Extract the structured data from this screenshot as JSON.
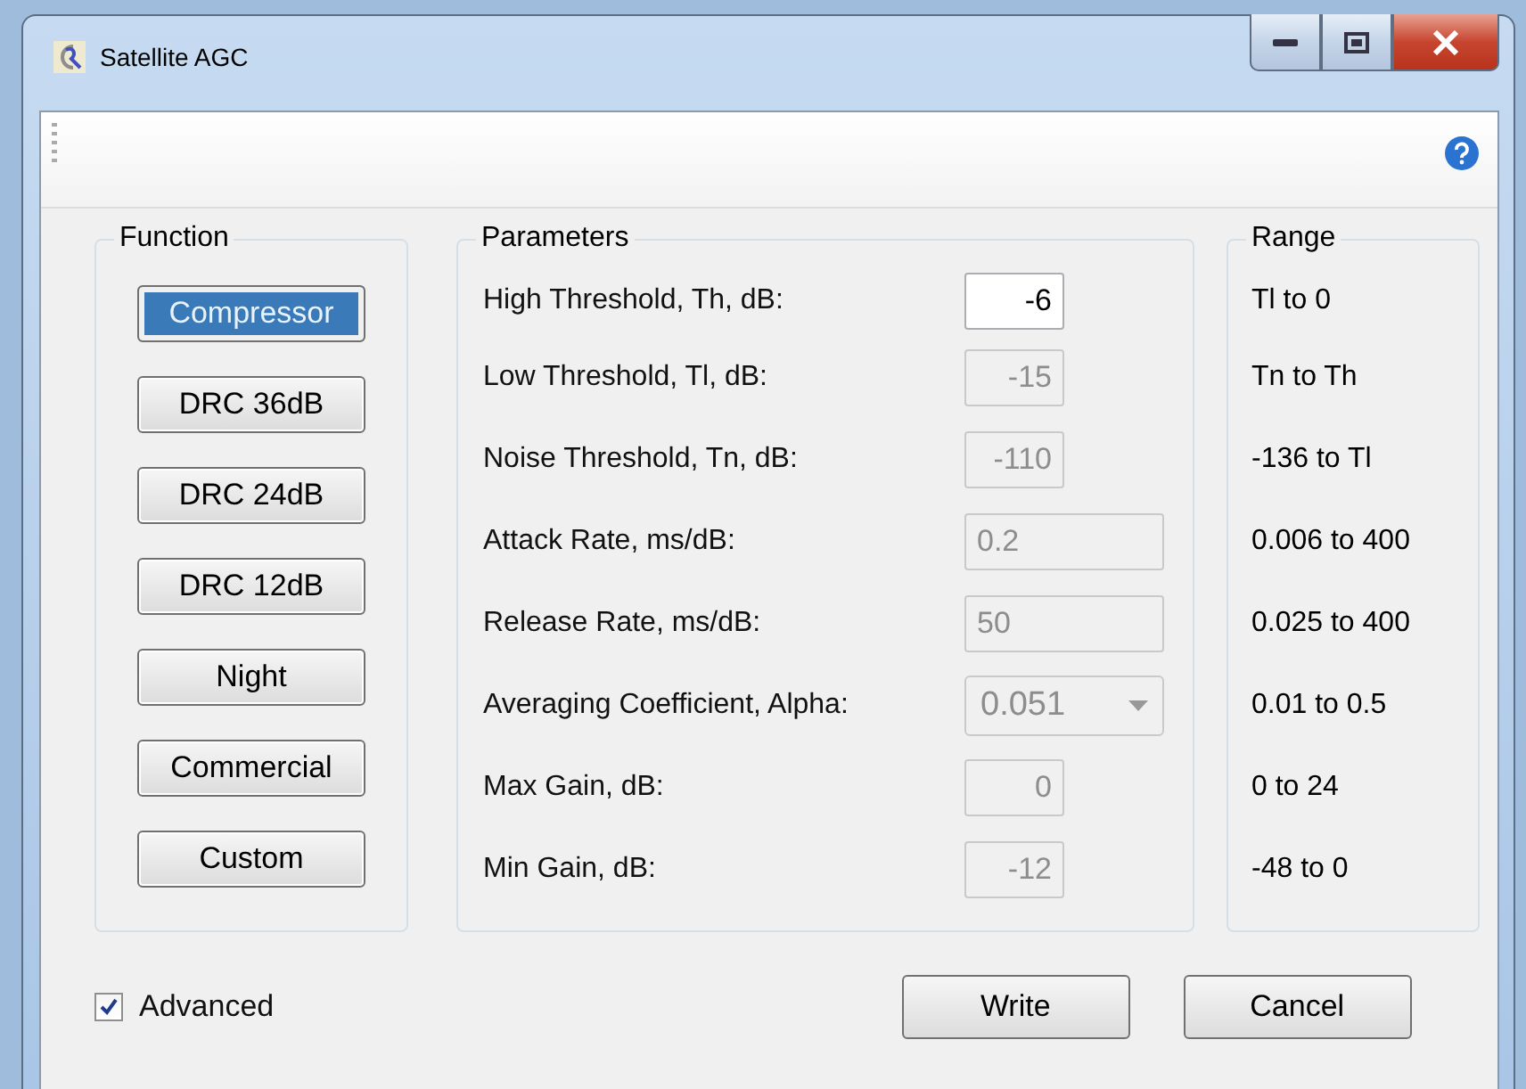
{
  "window": {
    "title": "Satellite AGC"
  },
  "function_group": {
    "title": "Function",
    "buttons": [
      {
        "label": "Compressor",
        "selected": true
      },
      {
        "label": "DRC 36dB",
        "selected": false
      },
      {
        "label": "DRC 24dB",
        "selected": false
      },
      {
        "label": "DRC 12dB",
        "selected": false
      },
      {
        "label": "Night",
        "selected": false
      },
      {
        "label": "Commercial",
        "selected": false
      },
      {
        "label": "Custom",
        "selected": false
      }
    ]
  },
  "parameters_group": {
    "title": "Parameters",
    "rows": [
      {
        "label": "High Threshold, Th, dB:",
        "value": "-6",
        "kind": "short",
        "disabled": false
      },
      {
        "label": "Low Threshold, Tl, dB:",
        "value": "-15",
        "kind": "short",
        "disabled": true
      },
      {
        "label": "Noise Threshold, Tn, dB:",
        "value": "-110",
        "kind": "short",
        "disabled": true
      },
      {
        "label": "Attack Rate, ms/dB:",
        "value": "0.2",
        "kind": "long",
        "disabled": true
      },
      {
        "label": "Release Rate, ms/dB:",
        "value": "50",
        "kind": "long",
        "disabled": true
      },
      {
        "label": "Averaging Coefficient, Alpha:",
        "value": "0.051",
        "kind": "combo",
        "disabled": true
      },
      {
        "label": "Max Gain, dB:",
        "value": "0",
        "kind": "short",
        "disabled": true
      },
      {
        "label": "Min Gain, dB:",
        "value": "-12",
        "kind": "short",
        "disabled": true
      }
    ]
  },
  "range_group": {
    "title": "Range",
    "rows": [
      "Tl to 0",
      "Tn to Th",
      "-136 to Tl",
      "0.006 to 400",
      "0.025 to 400",
      "0.01 to 0.5",
      "0 to 24",
      "-48 to 0"
    ]
  },
  "advanced": {
    "label": "Advanced",
    "checked": true
  },
  "buttons": [
    "Write",
    "Cancel"
  ]
}
